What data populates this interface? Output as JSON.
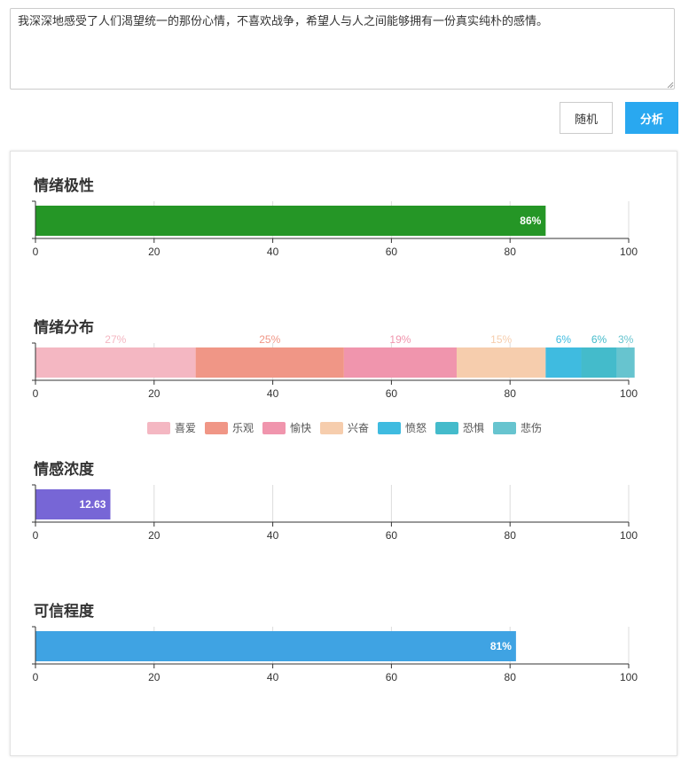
{
  "input": {
    "text": "我深深地感受了人们渴望统一的那份心情，不喜欢战争，希望人与人之间能够拥有一份真实纯朴的感情。"
  },
  "buttons": {
    "random": "随机",
    "analyze": "分析"
  },
  "colors": {
    "accent": "#29a8f0"
  },
  "chart_data": [
    {
      "type": "bar",
      "title": "情绪极性",
      "xlim": [
        0,
        100
      ],
      "ticks": [
        0,
        20,
        40,
        60,
        80,
        100
      ],
      "series": [
        {
          "value": 86,
          "label": "86%",
          "color": "#259626"
        }
      ]
    },
    {
      "type": "bar",
      "stacked": true,
      "title": "情绪分布",
      "xlim": [
        0,
        100
      ],
      "ticks": [
        0,
        20,
        40,
        60,
        80,
        100
      ],
      "legend_position": "bottom",
      "series": [
        {
          "name": "喜爱",
          "value": 27,
          "label": "27%",
          "color": "#f4b7c2"
        },
        {
          "name": "乐观",
          "value": 25,
          "label": "25%",
          "color": "#f09686"
        },
        {
          "name": "愉快",
          "value": 19,
          "label": "19%",
          "color": "#f095ad"
        },
        {
          "name": "兴奋",
          "value": 15,
          "label": "15%",
          "color": "#f6cdad"
        },
        {
          "name": "愤怒",
          "value": 6,
          "label": "6%",
          "color": "#3fbbe0"
        },
        {
          "name": "恐惧",
          "value": 6,
          "label": "6%",
          "color": "#44bbcb"
        },
        {
          "name": "悲伤",
          "value": 3,
          "label": "3%",
          "color": "#67c4cf"
        }
      ]
    },
    {
      "type": "bar",
      "title": "情感浓度",
      "xlim": [
        0,
        100
      ],
      "ticks": [
        0,
        20,
        40,
        60,
        80,
        100
      ],
      "series": [
        {
          "value": 12.63,
          "label": "12.63",
          "color": "#7766d6"
        }
      ]
    },
    {
      "type": "bar",
      "title": "可信程度",
      "xlim": [
        0,
        100
      ],
      "ticks": [
        0,
        20,
        40,
        60,
        80,
        100
      ],
      "series": [
        {
          "value": 81,
          "label": "81%",
          "color": "#3fa3e3"
        }
      ]
    }
  ]
}
